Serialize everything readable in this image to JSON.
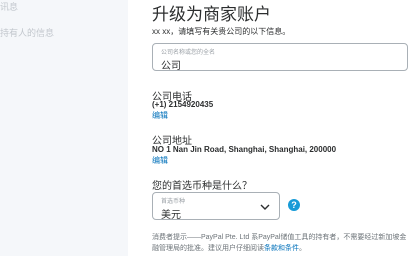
{
  "sidebar": {
    "items": [
      {
        "label": "讯息"
      },
      {
        "label": "持有人的信息"
      }
    ]
  },
  "main": {
    "title": "升级为商家账户",
    "instruction": "xx xx，请填写有关贵公司的以下信息。",
    "business_name": {
      "label": "公司名称或您的全名",
      "value": "公司"
    },
    "phone": {
      "title": "公司电话",
      "value": "(+1) 2154920435",
      "edit": "编辑"
    },
    "address": {
      "title": "公司地址",
      "value": "NO 1 Nan Jin Road, Shanghai, Shanghai, 200000",
      "edit": "编辑"
    },
    "currency": {
      "question": "您的首选币种是什么？",
      "label": "首选币种",
      "value": "美元"
    },
    "help_icon": "question-icon"
  },
  "footer": {
    "line1": "消费者提示——PayPal Pte. Ltd 系PayPal储值工具的持有者，不需要经过新加坡金",
    "line2_prefix": "融管理局的批准。建议用户仔细阅读",
    "terms_link": "条款和条件",
    "line2_suffix": "。"
  },
  "colors": {
    "link": "#0070ba",
    "help": "#179bd7",
    "border": "#a9b0b6",
    "sidebar_bg": "#f5f7fa"
  }
}
